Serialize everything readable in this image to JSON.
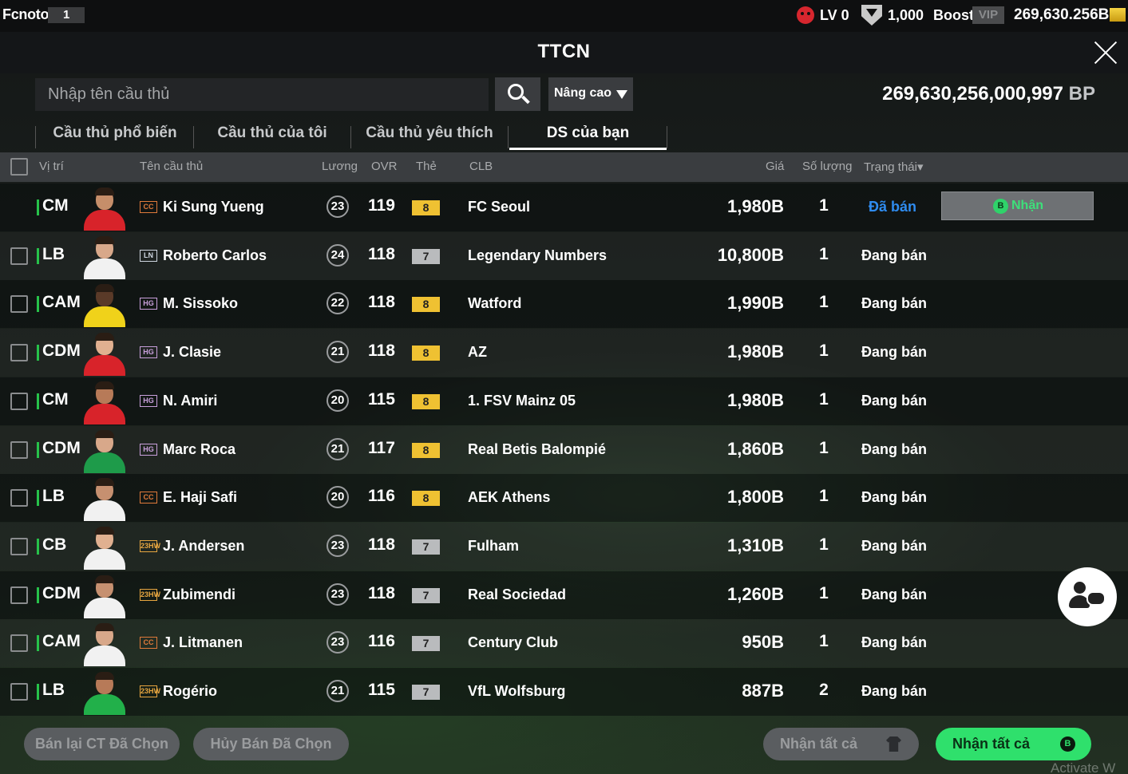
{
  "topbar": {
    "brand": "Fcnoto",
    "brand_num": "1",
    "level": "LV 0",
    "coins": "1,000",
    "boost": "Boost",
    "vip": "VIP",
    "bp": "269,630.256B"
  },
  "title": "TTCN",
  "search": {
    "placeholder": "Nhập tên cầu thủ",
    "advanced_label": "Nâng cao"
  },
  "bp_total": {
    "value": "269,630,256,000,997",
    "unit": "BP"
  },
  "tabs": [
    {
      "label": "Cầu thủ phổ biến"
    },
    {
      "label": "Cầu thủ của tôi"
    },
    {
      "label": "Cầu thủ yêu thích"
    },
    {
      "label": "DS của bạn"
    }
  ],
  "table": {
    "headers": {
      "position": "Vị trí",
      "name": "Tên cầu thủ",
      "salary": "Lương",
      "ovr": "OVR",
      "card": "Thẻ",
      "club": "CLB",
      "price": "Giá",
      "qty": "Số lượng",
      "status": "Trạng thái▾"
    },
    "rows": [
      {
        "pos": "CM",
        "season": "CC",
        "name": "Ki Sung Yueng",
        "salary": "23",
        "ovr": "119",
        "grade": "8",
        "club": "FC Seoul",
        "price": "1,980B",
        "qty": "1",
        "status": "Đã bán",
        "receive": "Nhận"
      },
      {
        "pos": "LB",
        "season": "LN",
        "name": "Roberto Carlos",
        "salary": "24",
        "ovr": "118",
        "grade": "7",
        "club": "Legendary Numbers",
        "price": "10,800B",
        "qty": "1",
        "status": "Đang bán"
      },
      {
        "pos": "CAM",
        "season": "HG",
        "name": "M. Sissoko",
        "salary": "22",
        "ovr": "118",
        "grade": "8",
        "club": "Watford",
        "price": "1,990B",
        "qty": "1",
        "status": "Đang bán"
      },
      {
        "pos": "CDM",
        "season": "HG",
        "name": "J. Clasie",
        "salary": "21",
        "ovr": "118",
        "grade": "8",
        "club": "AZ",
        "price": "1,980B",
        "qty": "1",
        "status": "Đang bán"
      },
      {
        "pos": "CM",
        "season": "HG",
        "name": "N. Amiri",
        "salary": "20",
        "ovr": "115",
        "grade": "8",
        "club": "1. FSV Mainz 05",
        "price": "1,980B",
        "qty": "1",
        "status": "Đang bán"
      },
      {
        "pos": "CDM",
        "season": "HG",
        "name": "Marc Roca",
        "salary": "21",
        "ovr": "117",
        "grade": "8",
        "club": "Real Betis Balompié",
        "price": "1,860B",
        "qty": "1",
        "status": "Đang bán"
      },
      {
        "pos": "LB",
        "season": "CC",
        "name": "E. Haji Safi",
        "salary": "20",
        "ovr": "116",
        "grade": "8",
        "club": "AEK Athens",
        "price": "1,800B",
        "qty": "1",
        "status": "Đang bán"
      },
      {
        "pos": "CB",
        "season": "23HW",
        "name": "J. Andersen",
        "salary": "23",
        "ovr": "118",
        "grade": "7",
        "club": "Fulham",
        "price": "1,310B",
        "qty": "1",
        "status": "Đang bán"
      },
      {
        "pos": "CDM",
        "season": "23HW",
        "name": "Zubimendi",
        "salary": "23",
        "ovr": "118",
        "grade": "7",
        "club": "Real Sociedad",
        "price": "1,260B",
        "qty": "1",
        "status": "Đang bán"
      },
      {
        "pos": "CAM",
        "season": "CC",
        "name": "J. Litmanen",
        "salary": "23",
        "ovr": "116",
        "grade": "7",
        "club": "Century Club",
        "price": "950B",
        "qty": "1",
        "status": "Đang bán"
      },
      {
        "pos": "LB",
        "season": "23HW",
        "name": "Rogério",
        "salary": "21",
        "ovr": "115",
        "grade": "7",
        "club": "VfL Wolfsburg",
        "price": "887B",
        "qty": "2",
        "status": "Đang bán"
      }
    ]
  },
  "bottom": {
    "resell_selected": "Bán lại CT Đã Chọn",
    "cancel_selected": "Hủy Bán Đã Chọn",
    "receive_all_gray": "Nhận tất cả",
    "receive_all_green": "Nhận tất cả"
  },
  "watermark": "Activate W",
  "colors": {
    "position_bar": "#27c24a",
    "sold_status": "#2f8cf0",
    "grade_gold": "#efc132",
    "grade_silver": "#b9bbbd",
    "green_button": "#2fe06c"
  }
}
